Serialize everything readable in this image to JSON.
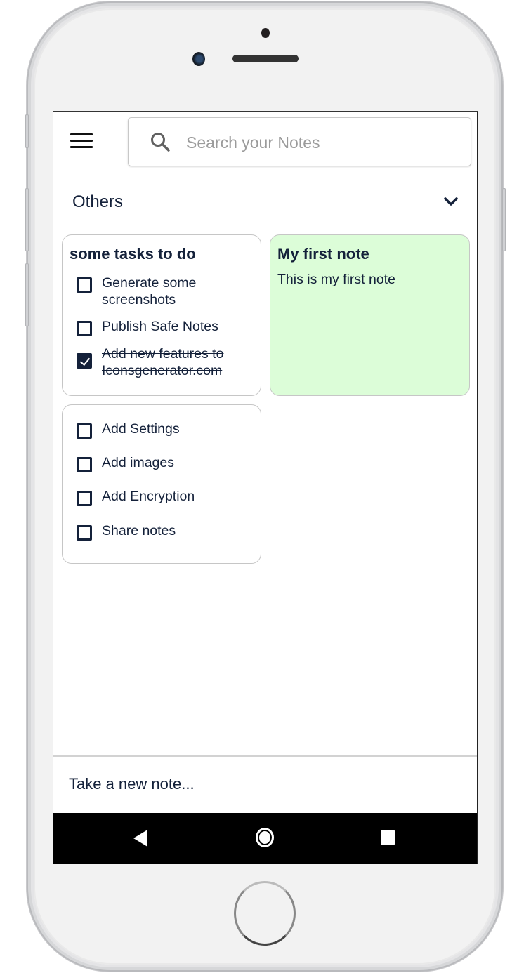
{
  "device": {
    "frame": "phone",
    "home_button_label": "home"
  },
  "topbar": {
    "menu_icon": "hamburger-menu-icon",
    "search": {
      "icon": "search-icon",
      "placeholder": "Search your Notes",
      "value": ""
    }
  },
  "section": {
    "title": "Others",
    "toggle_icon": "chevron-down-icon"
  },
  "notes": [
    {
      "type": "checklist",
      "title": "some tasks to do",
      "color": "#ffffff",
      "items": [
        {
          "text": "Generate some screenshots",
          "line1": "Generate some",
          "line2": "screenshots",
          "checked": false
        },
        {
          "text": "Publish Safe Notes",
          "checked": false
        },
        {
          "text": "Add new features to Iconsgenerator.com",
          "line1": "Add new features to",
          "line2": "Iconsgenerator.com",
          "checked": true
        }
      ]
    },
    {
      "type": "text",
      "title": "My first note",
      "body": "This is my first note",
      "color": "#dcfdd8"
    },
    {
      "type": "checklist",
      "title": "",
      "color": "#ffffff",
      "items": [
        {
          "text": "Add Settings",
          "checked": false
        },
        {
          "text": "Add images",
          "checked": false
        },
        {
          "text": "Add Encryption",
          "checked": false
        },
        {
          "text": "Share notes",
          "checked": false
        }
      ]
    }
  ],
  "composer": {
    "placeholder": "Take a new note..."
  },
  "navbar": {
    "back_icon": "back-triangle-icon",
    "home_icon": "home-circle-icon",
    "recents_icon": "recents-square-icon"
  },
  "colors": {
    "text_primary": "#14213a",
    "green_note": "#dcfdd8",
    "navbar": "#000000"
  }
}
